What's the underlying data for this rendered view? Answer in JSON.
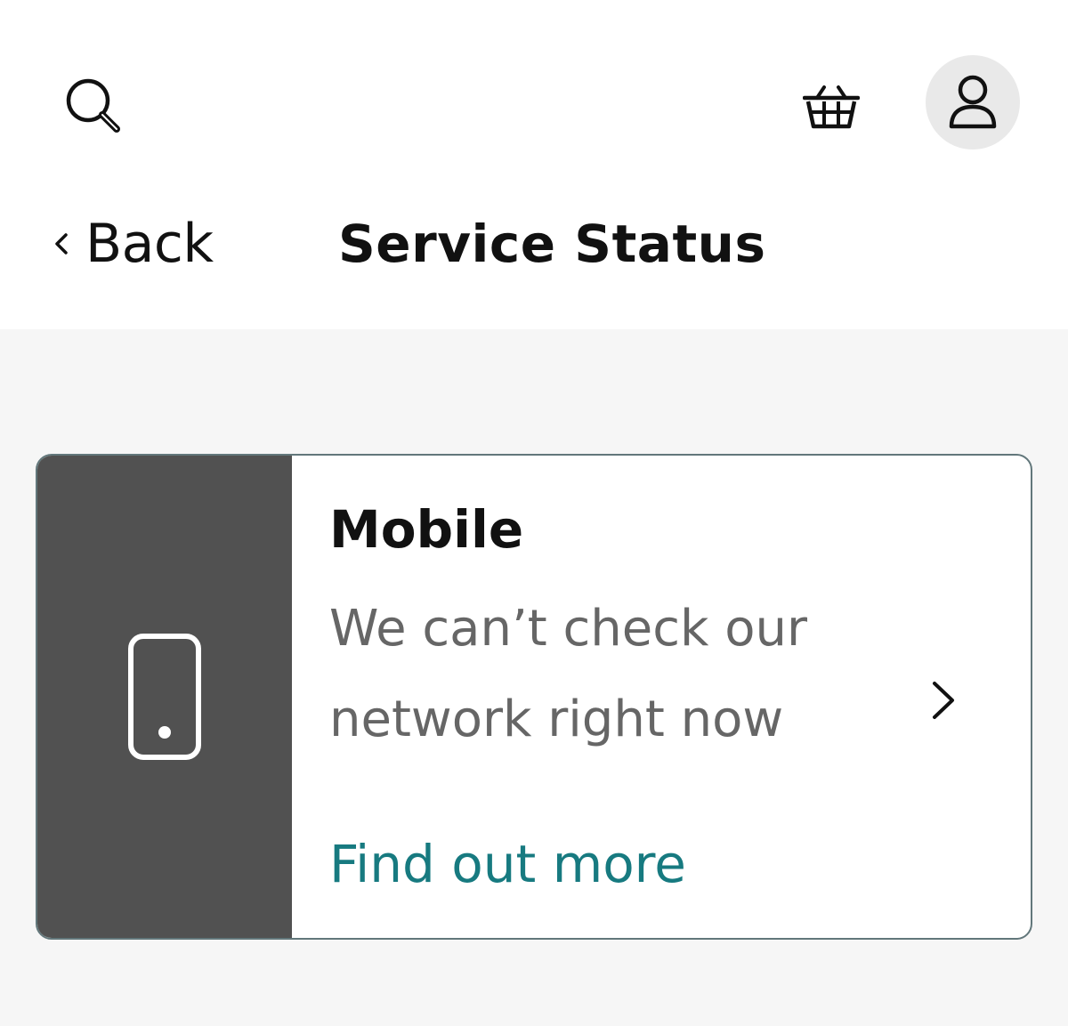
{
  "header": {
    "back_label": "Back",
    "title": "Service Status"
  },
  "topbar": {
    "icons": [
      "search-icon",
      "basket-icon",
      "account-icon"
    ]
  },
  "status_card": {
    "title": "Mobile",
    "message": "We can’t check our network right now",
    "link": "Find out more",
    "icon": "mobile-phone-icon"
  },
  "colors": {
    "accent": "#177a80",
    "card_side": "#515151",
    "card_border": "#62777b",
    "page_background": "#f6f6f6",
    "account_bg": "#e9e9e9"
  }
}
